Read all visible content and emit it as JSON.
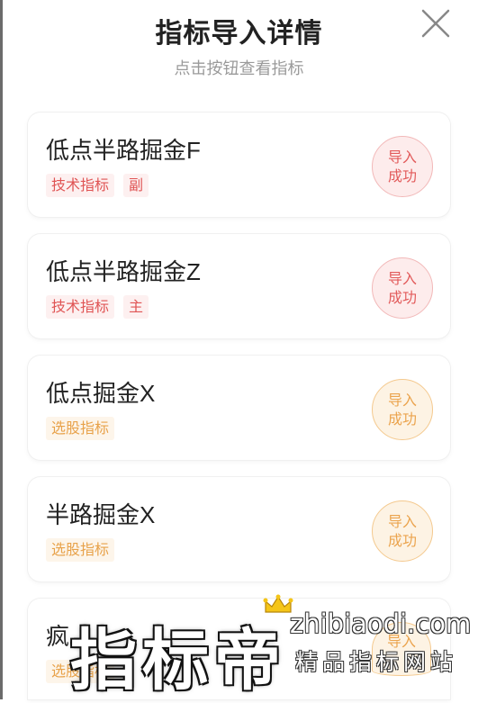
{
  "header": {
    "title": "指标导入详情",
    "subtitle": "点击按钮查看指标",
    "close_icon": "close-icon"
  },
  "cards": [
    {
      "name": "低点半路掘金F",
      "tags": [
        "技术指标",
        "副"
      ],
      "tag_style": "red",
      "status": [
        "导入",
        "成功"
      ]
    },
    {
      "name": "低点半路掘金Z",
      "tags": [
        "技术指标",
        "主"
      ],
      "tag_style": "red",
      "status": [
        "导入",
        "成功"
      ]
    },
    {
      "name": "低点掘金X",
      "tags": [
        "选股指标"
      ],
      "tag_style": "orange",
      "status": [
        "导入",
        "成功"
      ]
    },
    {
      "name": "半路掘金X",
      "tags": [
        "选股指标"
      ],
      "tag_style": "orange",
      "status": [
        "导入",
        "成功"
      ]
    },
    {
      "name": "疯",
      "tags": [
        "选股指标"
      ],
      "tag_style": "orange",
      "status": [
        "导入"
      ]
    }
  ],
  "watermark": {
    "brand": "指标帝",
    "domain": "zhibiaodi.com",
    "slogan": "精品指标网站"
  },
  "colors": {
    "tech_tag_text": "#e05555",
    "select_tag_text": "#e8a24a",
    "success_red": "#e25b5b",
    "success_orange": "#eba44e"
  }
}
